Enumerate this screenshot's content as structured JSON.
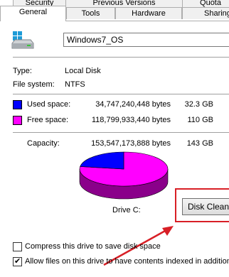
{
  "tabs_row1": [
    "Security",
    "Previous Versions",
    "Quota"
  ],
  "tabs_row2": [
    "General",
    "Tools",
    "Hardware",
    "Sharing"
  ],
  "active_tab": "General",
  "drive_name": "Windows7_OS",
  "type_label": "Type:",
  "type_value": "Local Disk",
  "fs_label": "File system:",
  "fs_value": "NTFS",
  "used": {
    "label": "Used space:",
    "bytes": "34,747,240,448 bytes",
    "size": "32.3 GB",
    "color": "#0000ff"
  },
  "free": {
    "label": "Free space:",
    "bytes": "118,799,933,440 bytes",
    "size": "110 GB",
    "color": "#ff00ff"
  },
  "capacity": {
    "label": "Capacity:",
    "bytes": "153,547,173,888 bytes",
    "size": "143 GB"
  },
  "drive_caption": "Drive C:",
  "cleanup_button": "Disk Cleanup",
  "compress_label": "Compress this drive to save disk space",
  "compress_checked": false,
  "index_label": "Allow files on this drive to have contents indexed in addition to",
  "index_checked": true,
  "used_fraction": 0.2263,
  "annotation_color": "#d81f26"
}
